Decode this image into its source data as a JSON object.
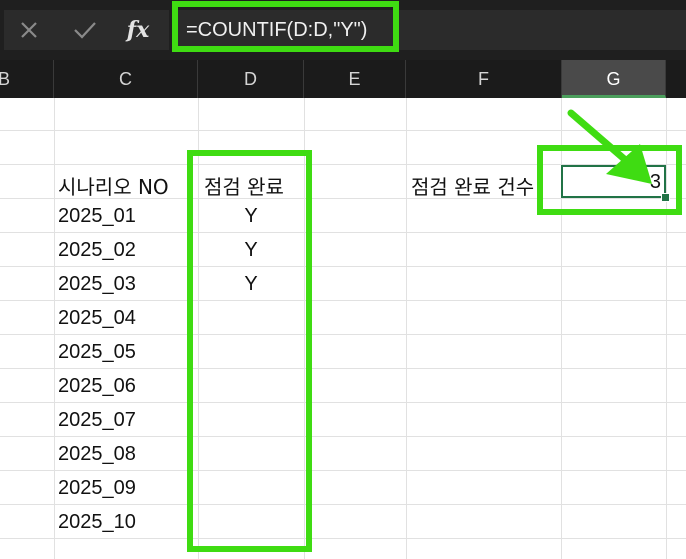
{
  "formula_bar": {
    "cancel_icon": "x-icon",
    "enter_icon": "check-icon",
    "fx_label": "fx",
    "formula": "=COUNTIF(D:D,\"Y\")"
  },
  "columns": [
    "B",
    "C",
    "D",
    "E",
    "F",
    "G"
  ],
  "selected_column": "G",
  "sheet": {
    "c_header": "시나리오 NO",
    "d_header": "점검 완료",
    "f_label": "점검 완료 건수",
    "g_value": "3",
    "rows": [
      {
        "c": "2025_01",
        "d": "Y"
      },
      {
        "c": "2025_02",
        "d": "Y"
      },
      {
        "c": "2025_03",
        "d": "Y"
      },
      {
        "c": "2025_04",
        "d": ""
      },
      {
        "c": "2025_05",
        "d": ""
      },
      {
        "c": "2025_06",
        "d": ""
      },
      {
        "c": "2025_07",
        "d": ""
      },
      {
        "c": "2025_08",
        "d": ""
      },
      {
        "c": "2025_09",
        "d": ""
      },
      {
        "c": "2025_10",
        "d": ""
      }
    ]
  },
  "colors": {
    "highlight": "#3fdc12",
    "selection": "#217346",
    "dark_bg": "#1f1f1f"
  }
}
